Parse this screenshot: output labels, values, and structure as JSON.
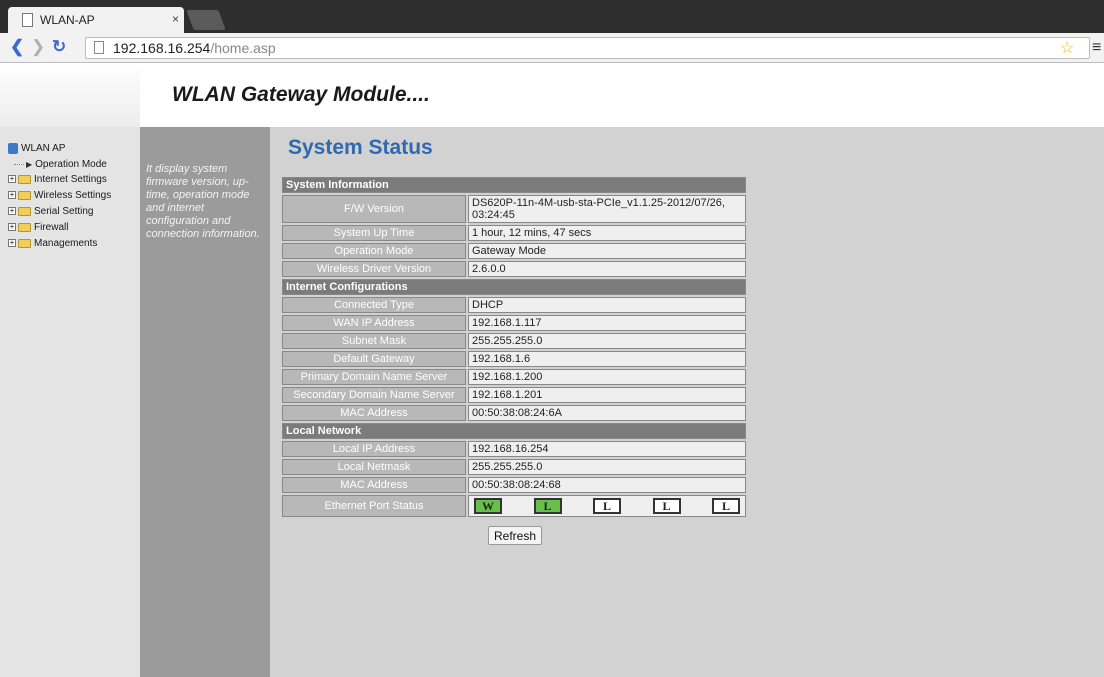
{
  "browser": {
    "tab_title": "WLAN-AP",
    "tab_close": "×",
    "url_host": "192.168.16.254",
    "url_path": "/home.asp"
  },
  "header": {
    "title": "WLAN Gateway Module...."
  },
  "tree": {
    "root": "WLAN AP",
    "items": [
      "Operation Mode",
      "Internet Settings",
      "Wireless Settings",
      "Serial Setting",
      "Firewall",
      "Managements"
    ]
  },
  "description": "It display system firmware version, up-time, operation mode and internet configuration and connection information.",
  "main": {
    "title": "System Status",
    "sections": [
      {
        "title": "System Information",
        "rows": [
          {
            "label": "F/W Version",
            "value": "DS620P-11n-4M-usb-sta-PCIe_v1.1.25-2012/07/26, 03:24:45"
          },
          {
            "label": "System Up Time",
            "value": "1 hour, 12 mins, 47 secs"
          },
          {
            "label": "Operation Mode",
            "value": "Gateway Mode"
          },
          {
            "label": "Wireless Driver Version",
            "value": "2.6.0.0"
          }
        ]
      },
      {
        "title": "Internet Configurations",
        "rows": [
          {
            "label": "Connected Type",
            "value": "DHCP"
          },
          {
            "label": "WAN IP Address",
            "value": "192.168.1.117"
          },
          {
            "label": "Subnet Mask",
            "value": "255.255.255.0"
          },
          {
            "label": "Default Gateway",
            "value": "192.168.1.6"
          },
          {
            "label": "Primary Domain Name Server",
            "value": "192.168.1.200"
          },
          {
            "label": "Secondary Domain Name Server",
            "value": "192.168.1.201"
          },
          {
            "label": "MAC Address",
            "value": "00:50:38:08:24:6A"
          }
        ]
      },
      {
        "title": "Local Network",
        "rows": [
          {
            "label": "Local IP Address",
            "value": "192.168.16.254"
          },
          {
            "label": "Local Netmask",
            "value": "255.255.255.0"
          },
          {
            "label": "MAC Address",
            "value": "00:50:38:08:24:68"
          }
        ]
      }
    ],
    "ethernet_label": "Ethernet Port Status",
    "ports": [
      {
        "letter": "W",
        "up": true
      },
      {
        "letter": "L",
        "up": true
      },
      {
        "letter": "L",
        "up": false
      },
      {
        "letter": "L",
        "up": false
      },
      {
        "letter": "L",
        "up": false
      }
    ],
    "refresh_label": "Refresh"
  },
  "colors": {
    "title_blue": "#2e6ab0",
    "port_up_green": "#66c04a",
    "section_gray": "#7b7b7b"
  }
}
